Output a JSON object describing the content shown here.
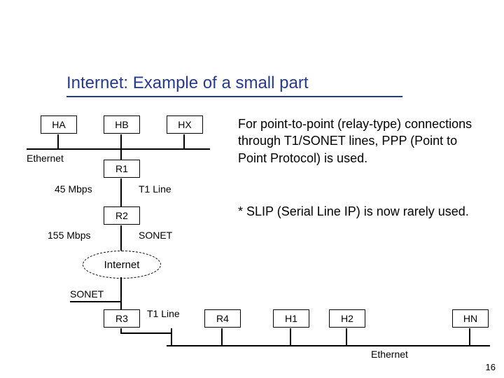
{
  "title": "Internet: Example of a small part",
  "hosts_top": {
    "ha": "HA",
    "hb": "HB",
    "hx": "HX"
  },
  "labels": {
    "ethernet_top": "Ethernet",
    "rate45": "45 Mbps",
    "t1a": "T1 Line",
    "rate155": "155 Mbps",
    "sonet_a": "SONET",
    "internet": "Internet",
    "sonet_b": "SONET",
    "t1b": "T1 Line",
    "ethernet_bottom": "Ethernet"
  },
  "routers": {
    "r1": "R1",
    "r2": "R2",
    "r3": "R3",
    "r4": "R4"
  },
  "hosts_bottom": {
    "h1": "H1",
    "h2": "H2",
    "hn": "HN"
  },
  "para1": "For point-to-point (relay-type) connections through T1/SONET lines, PPP (Point to Point Protocol) is used.",
  "para2": "* SLIP (Serial Line IP) is now rarely used.",
  "page": "16"
}
